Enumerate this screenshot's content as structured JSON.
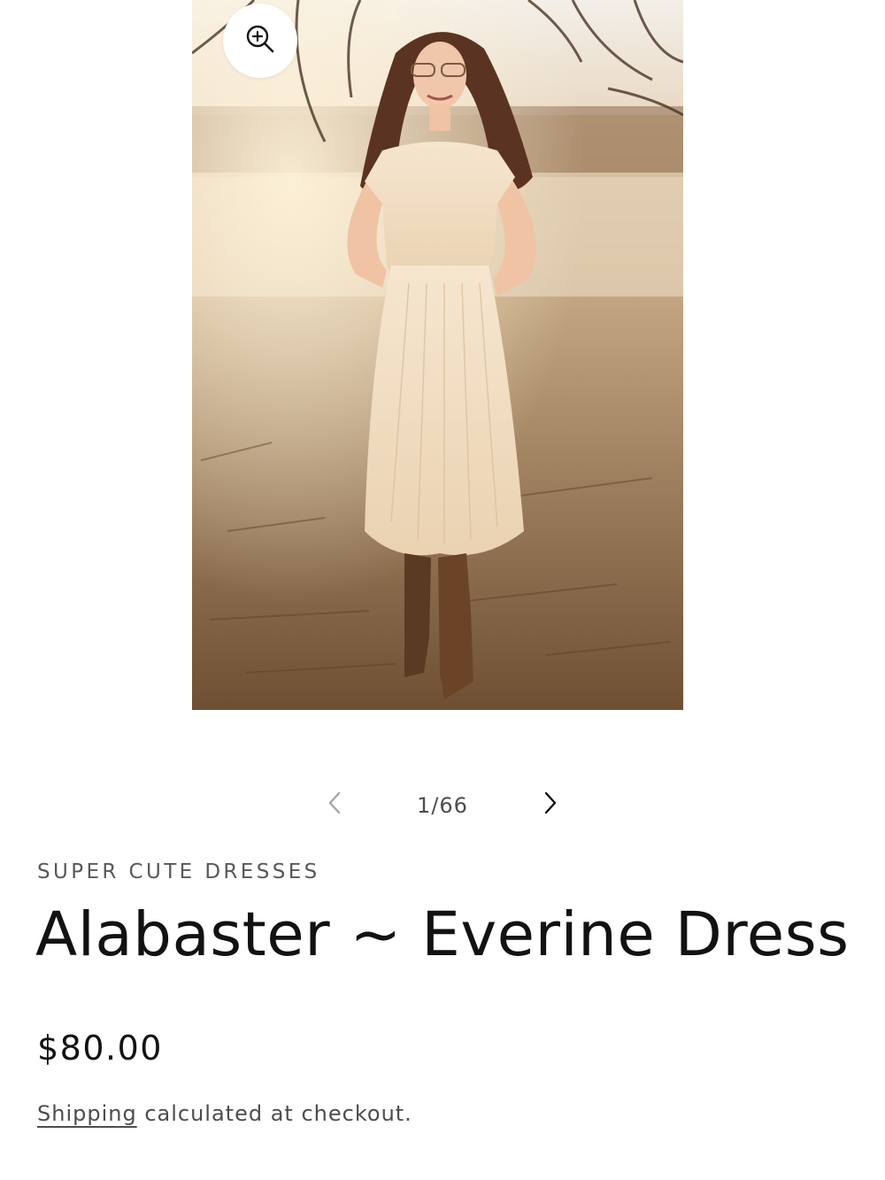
{
  "gallery": {
    "counter": "1/66",
    "image_description_icon": "product-photo",
    "zoom_icon": "zoom-in-icon",
    "prev_icon": "chevron-left-icon",
    "next_icon": "chevron-right-icon"
  },
  "product": {
    "vendor": "SUPER CUTE DRESSES",
    "title": "Alabaster ~ Everine Dress",
    "price": "$80.00",
    "shipping_link": "Shipping",
    "shipping_text": " calculated at checkout."
  },
  "colors": {
    "text": "#121212",
    "muted": "#4d4d4d",
    "background": "#ffffff"
  }
}
